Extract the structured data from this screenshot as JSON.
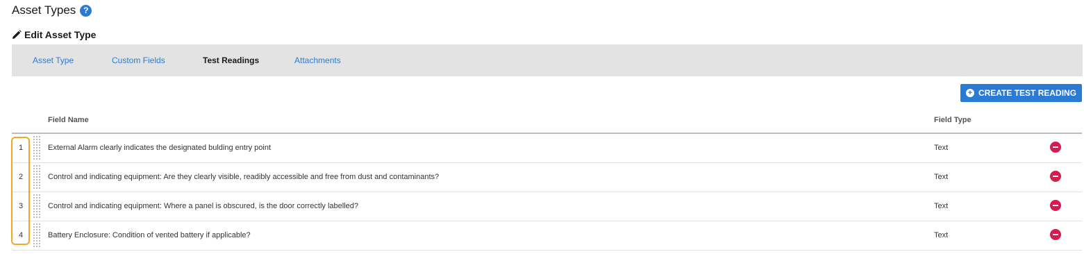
{
  "page": {
    "title": "Asset Types",
    "help_glyph": "?",
    "edit_heading": "Edit Asset Type"
  },
  "tabs": [
    {
      "label": "Asset Type",
      "active": false
    },
    {
      "label": "Custom Fields",
      "active": false
    },
    {
      "label": "Test Readings",
      "active": true
    },
    {
      "label": "Attachments",
      "active": false
    }
  ],
  "toolbar": {
    "create_label": "CREATE TEST READING"
  },
  "table": {
    "columns": [
      "Field Name",
      "Field Type"
    ],
    "rows": [
      {
        "num": "1",
        "name": "External Alarm clearly indicates the designated bulding entry point",
        "type": "Text"
      },
      {
        "num": "2",
        "name": "Control and indicating equipment: Are they clearly visible, readibly accessible and free from dust and contaminants?",
        "type": "Text"
      },
      {
        "num": "3",
        "name": "Control and indicating equipment: Where a panel is obscured, is the door correctly labelled?",
        "type": "Text"
      },
      {
        "num": "4",
        "name": "Battery Enclosure: Condition of vented battery if applicable?",
        "type": "Text"
      }
    ]
  },
  "colors": {
    "accent": "#2a7bd4",
    "tab_bar": "#e3e3e3",
    "remove": "#d81b4f",
    "highlight": "#f5a623"
  },
  "icons": [
    "help-icon",
    "pencil-icon",
    "plus-circle-icon",
    "drag-handle-icon",
    "remove-icon"
  ]
}
